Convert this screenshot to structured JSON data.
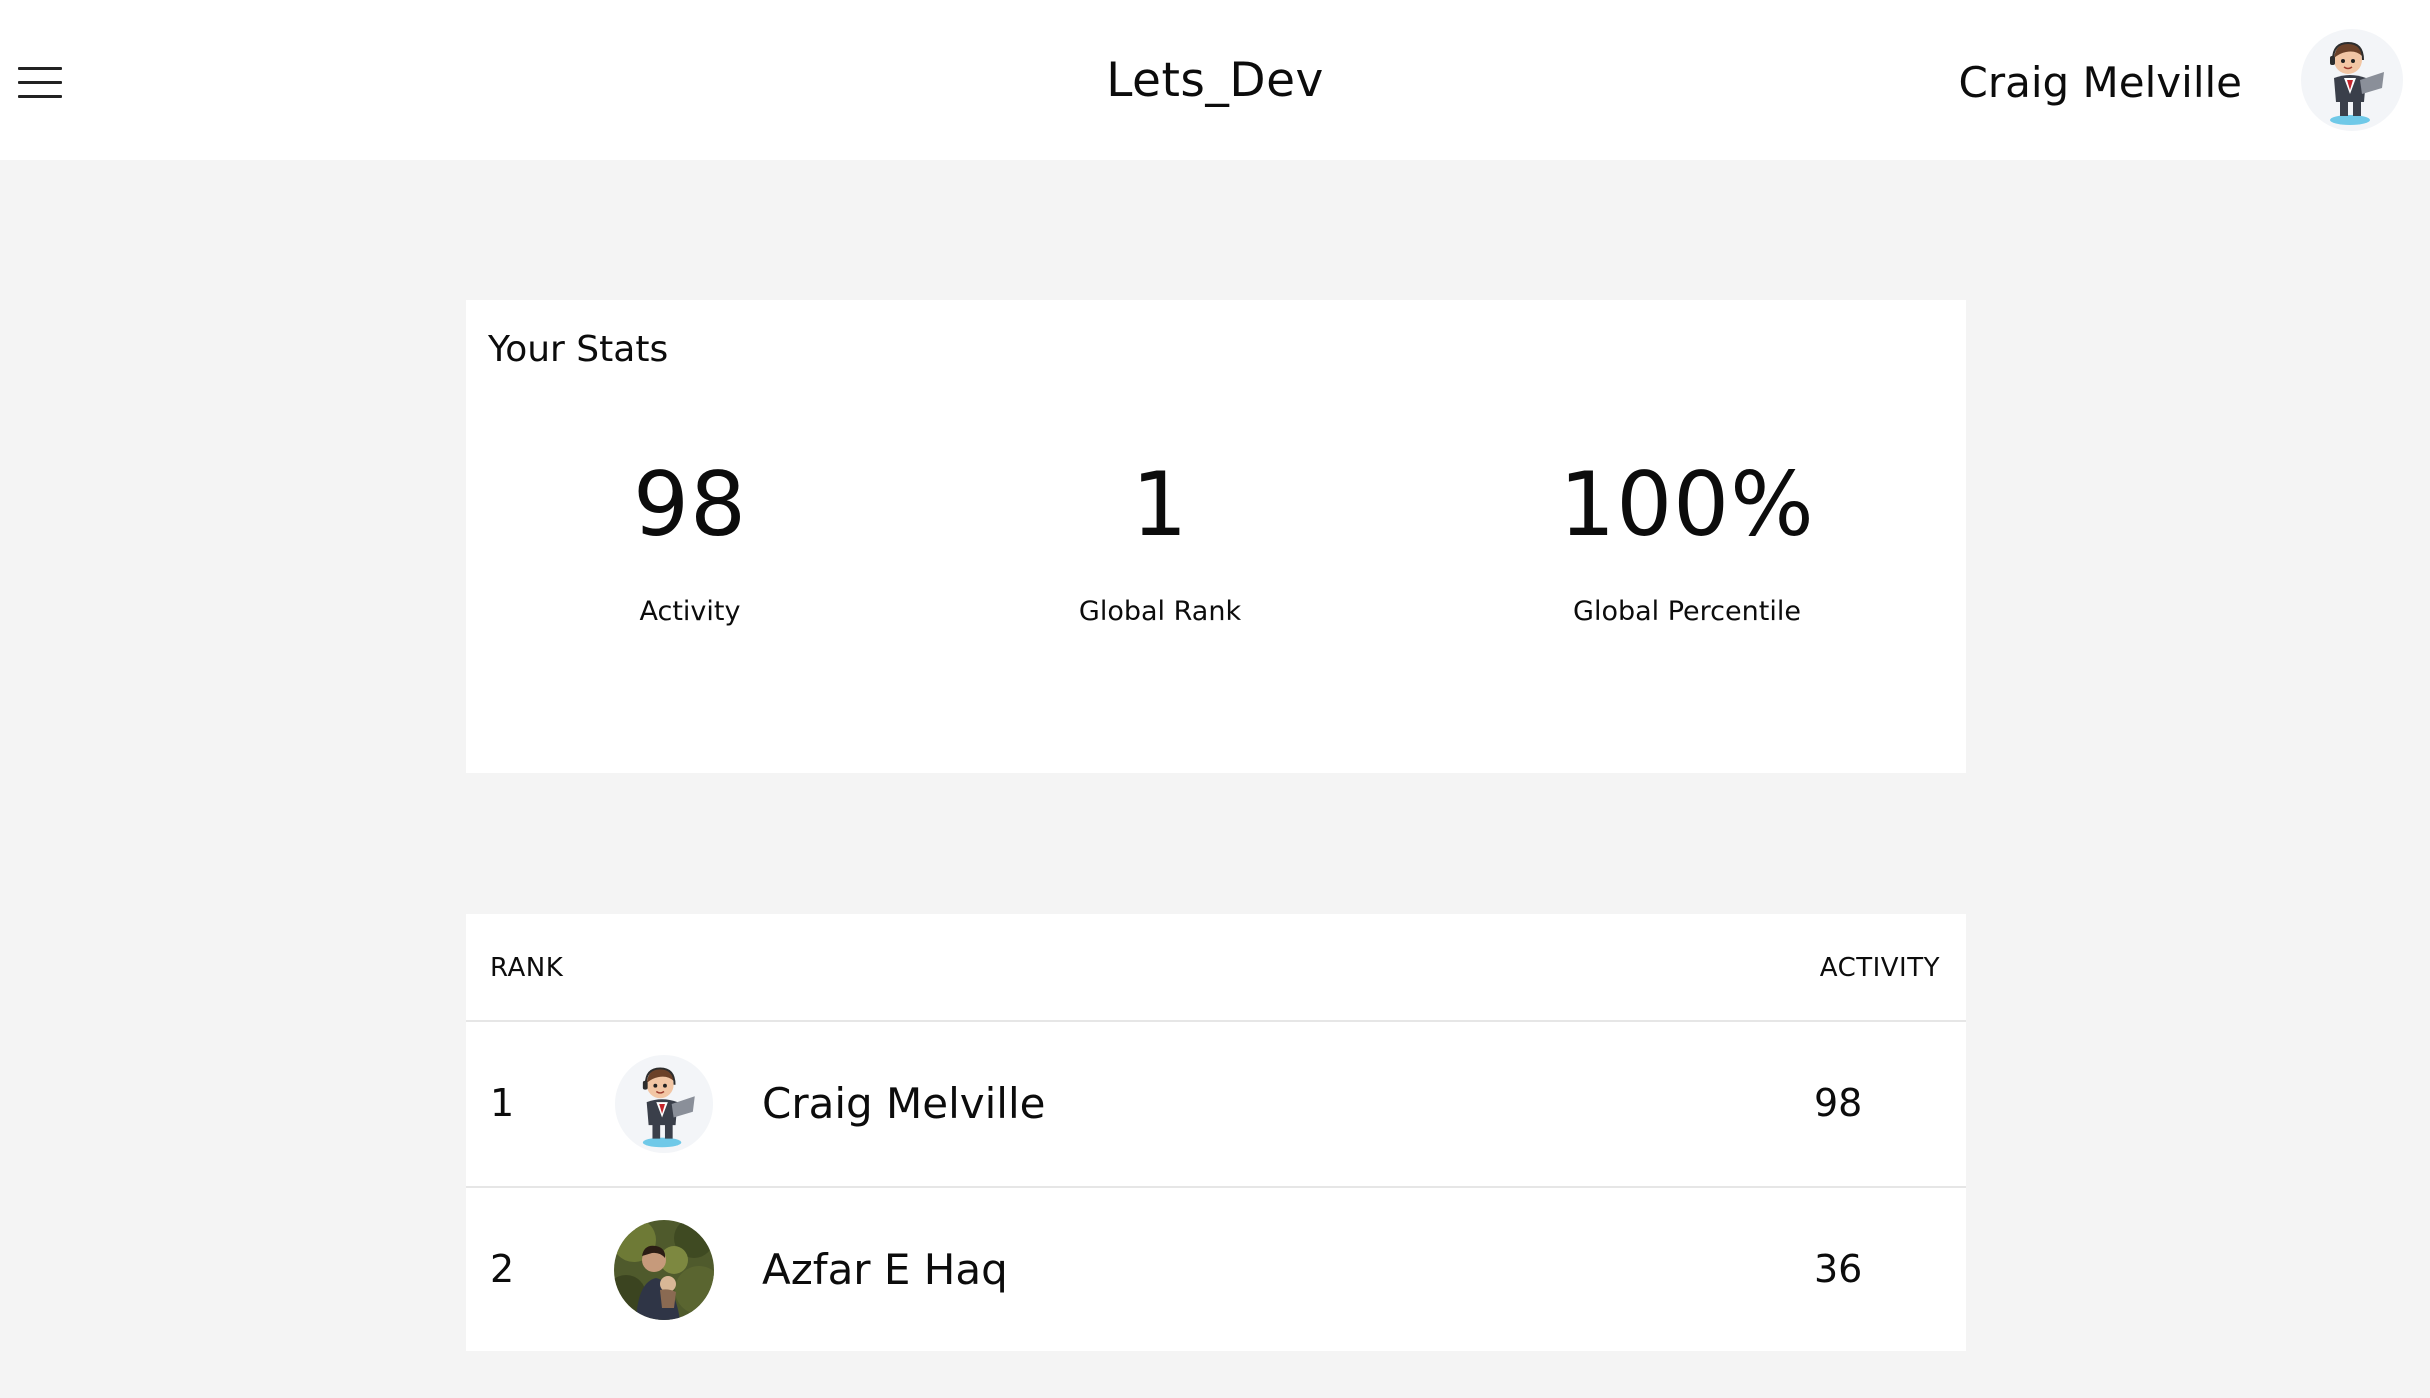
{
  "header": {
    "title": "Lets_Dev",
    "menu_icon": "hamburger-menu-icon",
    "user_name": "Craig Melville",
    "avatar_icon": "cartoon-developer-avatar"
  },
  "stats": {
    "title": "Your Stats",
    "items": [
      {
        "value": "98",
        "label": "Activity"
      },
      {
        "value": "1",
        "label": "Global Rank"
      },
      {
        "value": "100%",
        "label": "Global Percentile"
      }
    ]
  },
  "leaderboard": {
    "columns": {
      "rank": "RANK",
      "activity": "ACTIVITY"
    },
    "rows": [
      {
        "rank": "1",
        "name": "Craig Melville",
        "activity": "98",
        "avatar": "cartoon-developer-avatar"
      },
      {
        "rank": "2",
        "name": "Azfar E Haq",
        "activity": "36",
        "avatar": "photo-avatar"
      }
    ]
  },
  "colors": {
    "background": "#f4f4f4",
    "card": "#ffffff",
    "text": "#0c0c0c",
    "divider": "#e6e6e6"
  }
}
